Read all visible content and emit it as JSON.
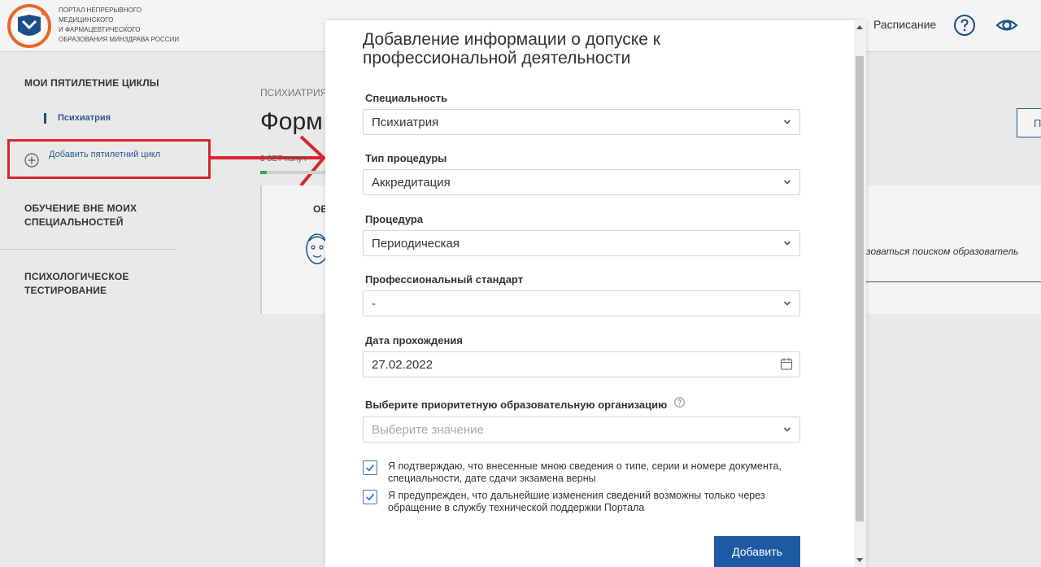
{
  "header": {
    "portal_name_lines": [
      "Портал непрерывного",
      "медицинского",
      "и фармацевтического",
      "образования Минздрава России"
    ],
    "schedule_link": "Расписание",
    "help_icon": "help-circle-icon",
    "eye_icon": "eye-icon"
  },
  "sidebar": {
    "my_cycles": "МОИ ПЯТИЛЕТНИЕ ЦИКЛЫ",
    "current_cycle": "Психиатрия",
    "add_cycle": "Добавить пятилетний цикл",
    "other_training": "ОБУЧЕНИЕ ВНЕ МОИХ СПЕЦИАЛЬНОСТЕЙ",
    "psych_testing": "ПСИХОЛОГИЧЕСКОЕ ТЕСТИРОВАНИЕ"
  },
  "main": {
    "breadcrumb": "ПСИХИАТРИЯ",
    "title": "Форм",
    "meta": "3 ЗЕТ получ",
    "card_label": "ОБ",
    "search_hint": "зоваться поиском образователь",
    "right_button": "П"
  },
  "modal": {
    "title": "Добавление информации о допуске к профессиональной деятельности",
    "fields": {
      "specialty": {
        "label": "Специальность",
        "value": "Психиатрия"
      },
      "procedure_type": {
        "label": "Тип процедуры",
        "value": "Аккредитация"
      },
      "procedure": {
        "label": "Процедура",
        "value": "Периодическая"
      },
      "standard": {
        "label": "Профессиональный стандарт",
        "value": "-"
      },
      "date": {
        "label": "Дата прохождения",
        "value": "27.02.2022"
      },
      "organization": {
        "label": "Выберите приоритетную образовательную организацию",
        "placeholder": "Выберите значение"
      }
    },
    "confirm_1": "Я подтверждаю, что внесенные мною сведения о типе, серии и номере документа, специальности, дате сдачи экзамена верны",
    "confirm_2": "Я предупрежден, что дальнейшие изменения сведений возможны только через обращение в службу технической поддержки Портала",
    "confirm_1_checked": true,
    "confirm_2_checked": true,
    "submit": "Добавить"
  },
  "colors": {
    "accent": "#1d5aa3",
    "highlight": "#d8252e",
    "logo_orange": "#e9672a"
  }
}
